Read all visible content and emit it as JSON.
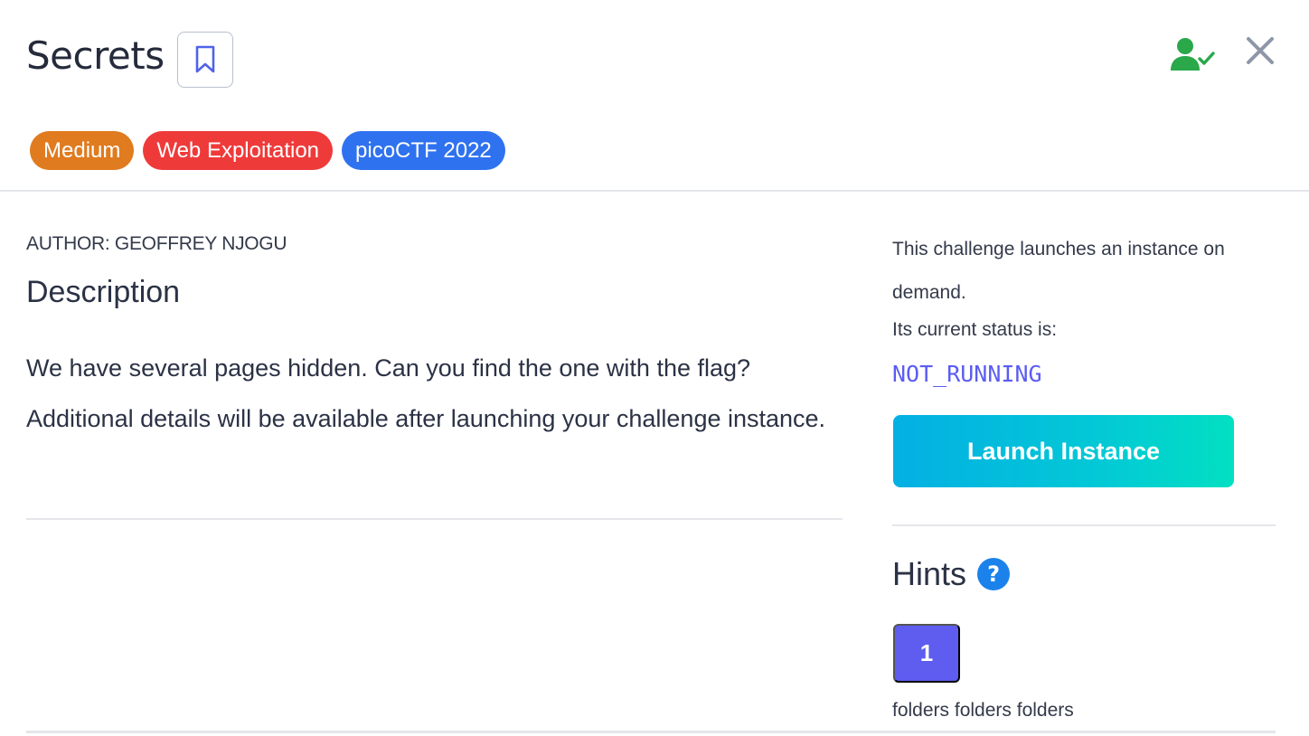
{
  "challenge": {
    "title": "Secrets",
    "bookmark_icon": "bookmark-icon",
    "solved_icon": "user-check-icon",
    "close_icon": "close-icon"
  },
  "tags": [
    {
      "label": "Medium",
      "color": "#e07b1f"
    },
    {
      "label": "Web Exploitation",
      "color": "#ef3a3a"
    },
    {
      "label": "picoCTF 2022",
      "color": "#2f72f0"
    }
  ],
  "details": {
    "author": "AUTHOR: GEOFFREY NJOGU",
    "description_heading": "Description",
    "description": "We have several pages hidden. Can you find the one with the flag? Additional details will be available after launching your challenge instance."
  },
  "instance": {
    "info": "This challenge launches an instance on demand.",
    "status_label": "Its current status is:",
    "status_value": "NOT_RUNNING",
    "launch_label": "Launch Instance"
  },
  "hints": {
    "heading": "Hints",
    "help_icon": "question-circle-icon",
    "items": [
      {
        "number": "1",
        "text": "folders folders folders"
      }
    ]
  },
  "colors": {
    "solved_green": "#2aa84a",
    "accent_purple": "#5e5df0",
    "status_text": "#5b5cf2"
  }
}
